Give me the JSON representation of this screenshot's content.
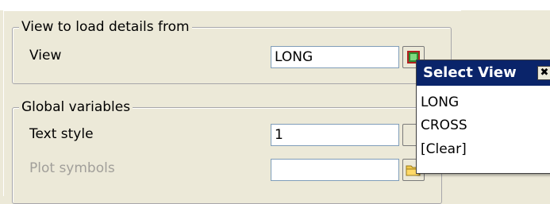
{
  "groups": {
    "view": {
      "title": "View to load details from",
      "view_label": "View",
      "view_value": "LONG"
    },
    "global": {
      "title": "Global variables",
      "text_style_label": "Text style",
      "text_style_value": "1",
      "plot_symbols_label": "Plot symbols",
      "plot_symbols_value": ""
    }
  },
  "popup": {
    "title": "Select View",
    "close_glyph": "✖",
    "items": [
      "LONG",
      "CROSS",
      "[Clear]"
    ]
  }
}
